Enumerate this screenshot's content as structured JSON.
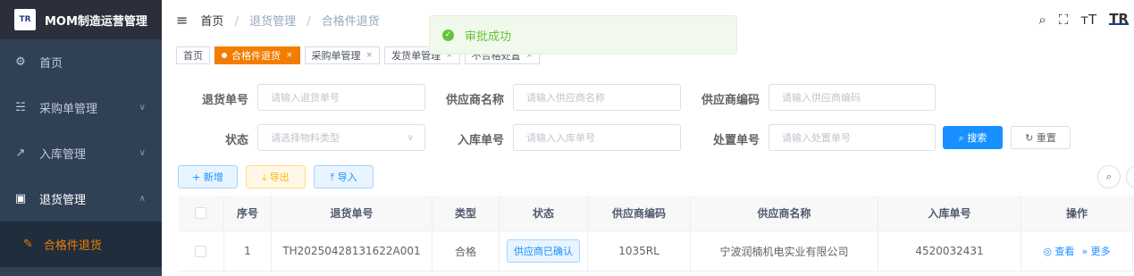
{
  "app": {
    "logo_text": "TR",
    "title": "MOM制造运营管理"
  },
  "sidebar": {
    "items": [
      {
        "icon": "dashboard-icon",
        "glyph": "⚙",
        "label": "首页",
        "chevron": ""
      },
      {
        "icon": "cart-icon",
        "glyph": "☵",
        "label": "采购单管理",
        "chevron": "∨"
      },
      {
        "icon": "external-link-icon",
        "glyph": "↗",
        "label": "入库管理",
        "chevron": "∨"
      },
      {
        "icon": "return-icon",
        "glyph": "▣",
        "label": "退货管理",
        "chevron": "∧"
      }
    ],
    "sub_item": {
      "icon": "edit-icon",
      "glyph": "✎",
      "label": "合格件退货"
    }
  },
  "breadcrumb": {
    "home": "首页",
    "level2": "退货管理",
    "level3": "合格件退货",
    "separator": "/"
  },
  "topbar_icons": [
    "search-icon",
    "fullscreen-icon",
    "font-size-icon",
    "brand-logo-icon"
  ],
  "topbar_glyphs": {
    "search": "⌕",
    "fullscreen": "⛶",
    "font_size": "тT",
    "brand": "TR"
  },
  "toast": {
    "message": "审批成功",
    "glyph": "✓",
    "color": "#67c23a"
  },
  "tags": [
    {
      "label": "首页",
      "active": false,
      "closable": false
    },
    {
      "label": "合格件退货",
      "active": true,
      "closable": true
    },
    {
      "label": "采购单管理",
      "active": false,
      "closable": true
    },
    {
      "label": "发货单管理",
      "active": false,
      "closable": true
    },
    {
      "label": "不合格处置",
      "active": false,
      "closable": true
    }
  ],
  "form": {
    "return_no": {
      "label": "退货单号",
      "placeholder": "请输入退货单号"
    },
    "supplier_name": {
      "label": "供应商名称",
      "placeholder": "请输入供应商名称"
    },
    "supplier_code": {
      "label": "供应商编码",
      "placeholder": "请输入供应商编码"
    },
    "status": {
      "label": "状态",
      "placeholder": "请选择物料类型"
    },
    "inbound_no": {
      "label": "入库单号",
      "placeholder": "请输入入库单号"
    },
    "disposal_no": {
      "label": "处置单号",
      "placeholder": "请输入处置单号"
    },
    "search_button": "⌕ 搜索",
    "reset_button": "↻ 重置"
  },
  "toolbar": {
    "add": "+ 新增",
    "export": "⤓ 导出",
    "import": "⤒ 导入",
    "search_toggle_glyph": "⌕"
  },
  "table": {
    "columns": [
      "序号",
      "退货单号",
      "类型",
      "状态",
      "供应商编码",
      "供应商名称",
      "入库单号",
      "操作"
    ],
    "rows": [
      {
        "index": "1",
        "return_no": "TH20250428131622A001",
        "type": "合格",
        "status": "供应商已确认",
        "supplier_code": "1035RL",
        "supplier_name": "宁波润楠机电实业有限公司",
        "inbound_no": "4520032431",
        "view": "◎ 查看",
        "more": "» 更多"
      }
    ]
  },
  "colors": {
    "sidebar_bg": "#304156",
    "accent": "#f27d00",
    "primary": "#1890ff",
    "success": "#67c23a"
  }
}
